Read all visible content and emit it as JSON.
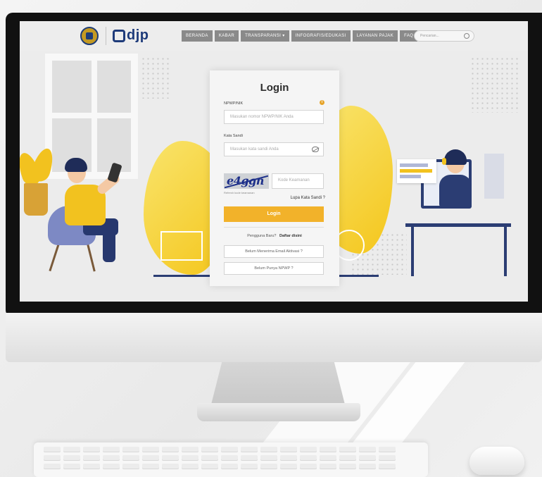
{
  "nav": {
    "brand": "djp",
    "items": [
      "BERANDA",
      "KABAR",
      "TRANSPARANSI ▾",
      "INFOGRAFIS/EDUKASI",
      "LAYANAN PAJAK",
      "FAQ"
    ],
    "search_placeholder": "Pencarian..."
  },
  "login": {
    "title": "Login",
    "npwp_label": "NPWP/NIK",
    "npwp_placeholder": "Masukan nomor NPWP/NIK Anda",
    "password_label": "Kata Sandi",
    "password_placeholder": "Masukan kata sandi Anda",
    "captcha_text": "e4ggn",
    "captcha_placeholder": "Kode Keamanan",
    "captcha_note": "Refresh kode keamanan",
    "forgot_password": "Lupa Kata Sandi ?",
    "login_button": "Login",
    "signup_prompt": "Pengguna Baru?",
    "signup_link": "Daftar disini",
    "activation_button": "Belum Menerima Email Aktivasi ?",
    "no_npwp_button": "Belum Punya NPWP ?"
  },
  "colors": {
    "accent": "#f2b22a",
    "brand_blue": "#1e3b7a",
    "illustration_yellow": "#f2c21f"
  }
}
